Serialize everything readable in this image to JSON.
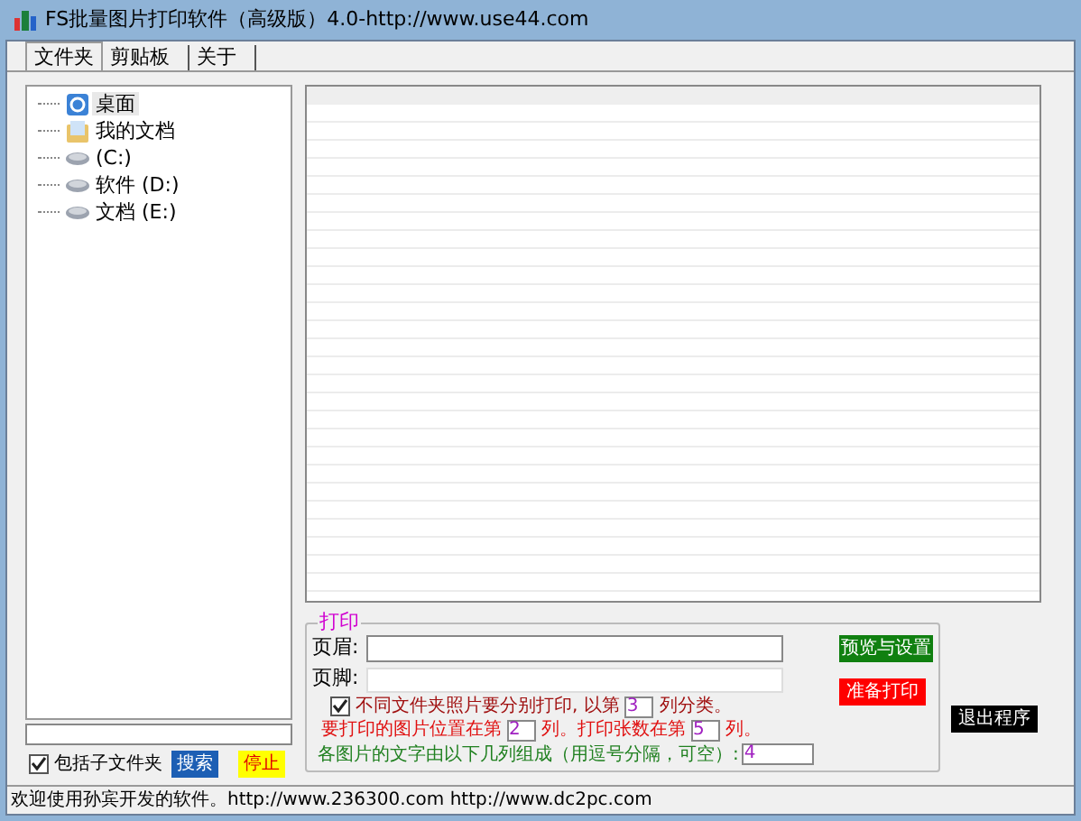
{
  "window": {
    "title": "FS批量图片打印软件（高级版）4.0-http://www.use44.com"
  },
  "tabs": [
    {
      "label": "文件夹",
      "selected": true
    },
    {
      "label": "剪贴板",
      "selected": false
    },
    {
      "label": "关于",
      "selected": false
    }
  ],
  "tree": [
    {
      "label": "桌面",
      "kind": "desktop",
      "selected": true
    },
    {
      "label": "我的文档",
      "kind": "documents",
      "selected": false
    },
    {
      "label": "(C:)",
      "kind": "drive",
      "selected": false
    },
    {
      "label": "软件 (D:)",
      "kind": "drive",
      "selected": false
    },
    {
      "label": "文档 (E:)",
      "kind": "drive",
      "selected": false
    }
  ],
  "include_subfolders": {
    "label": "包括子文件夹",
    "checked": true
  },
  "search_button": "搜索",
  "stop_button": "停止",
  "print_group": {
    "title": "打印",
    "header_label": "页眉:",
    "footer_label": "页脚:",
    "separate": {
      "checked": true,
      "before": "不同文件夹照片要分别打印, 以第",
      "value": "3",
      "after": "列分类。"
    },
    "position": {
      "before": "要打印的图片位置在第",
      "value": "2",
      "middle": "列。打印张数在第",
      "count": "5",
      "after": "列。"
    },
    "caption": {
      "label": "各图片的文字由以下几列组成（用逗号分隔，可空）:",
      "value": "4"
    }
  },
  "preview_button": "预览与设置",
  "print_button": "准备打印",
  "exit_button": "退出程序",
  "status_bar": "欢迎使用孙宾开发的软件。http://www.236300.com http://www.dc2pc.com"
}
